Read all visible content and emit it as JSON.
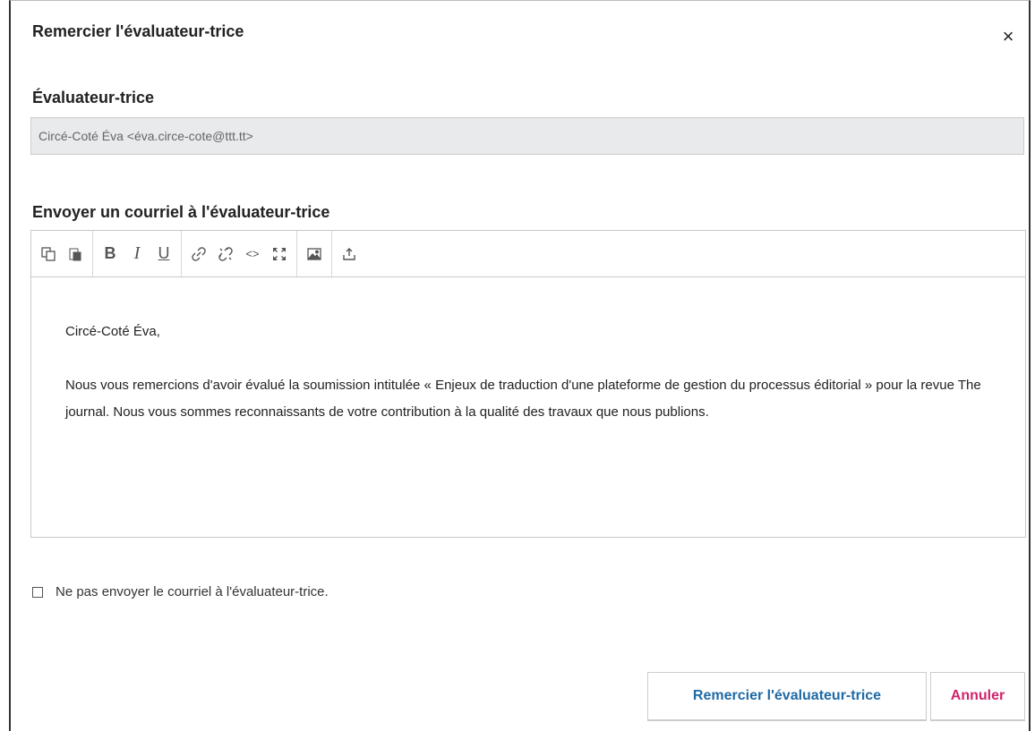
{
  "modal": {
    "title": "Remercier l'évaluateur-trice",
    "close_label": "×"
  },
  "reviewer": {
    "label": "Évaluateur-trice",
    "value": "Circé-Coté Éva <éva.circe-cote@ttt.tt>"
  },
  "email": {
    "label": "Envoyer un courriel à l'évaluateur-trice",
    "greeting": "Circé-Coté Éva,",
    "body": "Nous vous remercions d'avoir évalué la soumission intitulée « Enjeux de traduction d'une plateforme de gestion du processus éditorial » pour la revue The journal. Nous vous sommes reconnaissants de votre contribution à la qualité des travaux que nous publions."
  },
  "toolbar": {
    "bold": "B",
    "italic": "I",
    "underline": "U",
    "code": "<>"
  },
  "skip_email": {
    "label": "Ne pas envoyer le courriel à l'évaluateur-trice."
  },
  "actions": {
    "confirm": "Remercier l'évaluateur-trice",
    "cancel": "Annuler"
  }
}
